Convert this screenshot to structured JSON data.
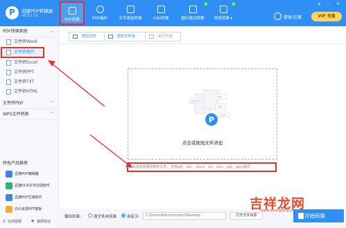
{
  "app": {
    "name": "迅捷PDF转换器",
    "version": "v8.5.1.13"
  },
  "nav": [
    {
      "label": "PDF转换",
      "active": true,
      "icon": "pdf-convert-icon"
    },
    {
      "label": "PDF操作",
      "icon": "pdf-operate-icon"
    },
    {
      "label": "文字语音转换",
      "icon": "text-voice-icon"
    },
    {
      "label": "CAD转换",
      "icon": "cad-icon"
    },
    {
      "label": "图片格式转换",
      "icon": "image-format-icon",
      "badge": "新"
    },
    {
      "label": "特色转换 ▾",
      "icon": "special-convert-icon",
      "badge": "新"
    }
  ],
  "header": {
    "login": "登录/注册",
    "vip": "VIP 充值"
  },
  "sidebar": {
    "groups": [
      {
        "label": "PDF转换其他",
        "items": [
          "文件转Word",
          "文件转图片",
          "文件转Excel",
          "文件转PPT",
          "文件转TXT",
          "文件转HTML"
        ]
      },
      {
        "label": "文件转PDF"
      },
      {
        "label": "WPS文件转换"
      }
    ],
    "special_title": "特色产品推荐",
    "special": [
      "迅捷PDF编辑器",
      "迅捷OCR文字识别软件",
      "迅捷PDF压缩软件",
      "办公资源PPT模板"
    ],
    "footer": {
      "service": "在线客服",
      "website": "官网地址"
    }
  },
  "toolbar": {
    "add_file": "添加文件",
    "add_folder": "添加文件夹",
    "clear": "清空列表"
  },
  "dropzone": {
    "text": "点击或拖拽文件添加",
    "doc_labels": [
      "word",
      "txt",
      "xls",
      "ppt"
    ]
  },
  "hint": "*请添加需要转换的文件，支持pdf、doc、docx、xls、xlsx、ppt、pptx格式",
  "bottom": {
    "output_label": "输出目录:",
    "radio_source": "原文件夹目录",
    "radio_custom": "自定义:",
    "path": "C:/Users/Administrator/Desktop",
    "open_folder": "打开文件目录",
    "start": "开始转换"
  },
  "watermark": {
    "text": "吉祥龙网",
    "sub": "www.jixianglong.cn"
  },
  "colors": {
    "primary": "#2f8ff5",
    "highlight": "#e53030"
  }
}
